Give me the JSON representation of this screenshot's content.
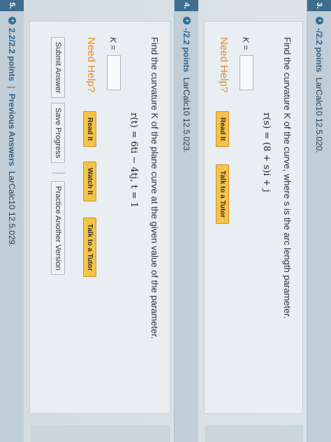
{
  "q3": {
    "number": "3.",
    "points": "-/2.2 points",
    "source": "LarCalc10 12.5.020.",
    "prompt": "Find the curvature K of the curve, where s is the arc length parameter.",
    "equation": "r(s) = (8 + s)i + j",
    "k_label": "K =",
    "need_help": "Need Help?",
    "read_it": "Read It",
    "talk_to_tutor": "Talk to a Tutor"
  },
  "q4": {
    "number": "4.",
    "points": "-/2.2 points",
    "source": "LarCalc10 12.5.023.",
    "prompt": "Find the curvature K of the plane curve at the given value of the parameter.",
    "equation": "r(t) = 6ti − 4tj,   t = 1",
    "k_label": "K =",
    "need_help": "Need Help?",
    "read_it": "Read It",
    "watch_it": "Watch It",
    "talk_to_tutor": "Talk to a Tutor",
    "submit_answer": "Submit Answer",
    "save_progress": "Save Progress",
    "practice_another": "Practice Another Version"
  },
  "q5": {
    "number": "5.",
    "points": "2.2/2.2 points",
    "separator": "|",
    "previous_answers": "Previous Answers",
    "source": "LarCalc10 12.5.029."
  },
  "icons": {
    "status": "plus-circle-icon"
  },
  "colors": {
    "accent": "#2e5f86",
    "help": "#ea8a1f",
    "button": "#f6c34a"
  }
}
